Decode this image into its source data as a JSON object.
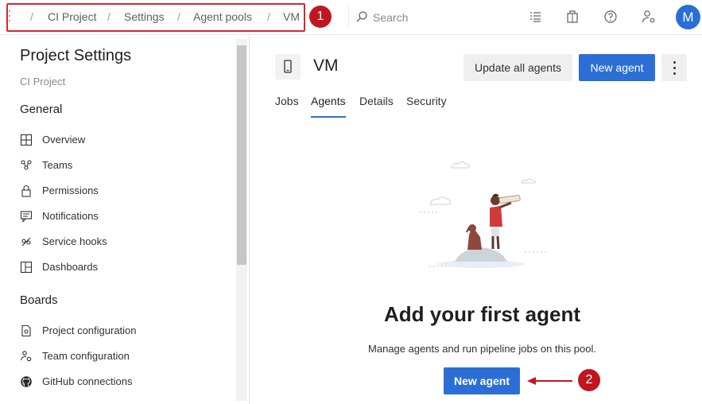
{
  "breadcrumb": {
    "items": [
      "CI Project",
      "Settings",
      "Agent pools",
      "VM"
    ],
    "separator": "/"
  },
  "annotations": {
    "badge_1": "1",
    "badge_2": "2",
    "color": "#c1161f"
  },
  "search": {
    "placeholder": "Search"
  },
  "user": {
    "avatar_initial": "M"
  },
  "sidebar": {
    "title": "Project Settings",
    "project": "CI Project",
    "sections": [
      {
        "title": "General",
        "items": [
          {
            "label": "Overview",
            "icon": "overview-icon"
          },
          {
            "label": "Teams",
            "icon": "teams-icon"
          },
          {
            "label": "Permissions",
            "icon": "lock-icon"
          },
          {
            "label": "Notifications",
            "icon": "notification-icon"
          },
          {
            "label": "Service hooks",
            "icon": "service-hooks-icon"
          },
          {
            "label": "Dashboards",
            "icon": "dashboard-icon"
          }
        ]
      },
      {
        "title": "Boards",
        "items": [
          {
            "label": "Project configuration",
            "icon": "project-config-icon"
          },
          {
            "label": "Team configuration",
            "icon": "team-config-icon"
          },
          {
            "label": "GitHub connections",
            "icon": "github-icon"
          }
        ]
      }
    ]
  },
  "pool": {
    "name": "VM",
    "update_all_label": "Update all agents",
    "new_agent_label": "New agent",
    "tabs": [
      "Jobs",
      "Agents",
      "Details",
      "Security"
    ],
    "active_tab": "Agents"
  },
  "empty_state": {
    "title": "Add your first agent",
    "description": "Manage agents and run pipeline jobs on this pool.",
    "button_label": "New agent"
  },
  "colors": {
    "accent": "#2b6fd6",
    "annotation_red": "#c1161f"
  }
}
